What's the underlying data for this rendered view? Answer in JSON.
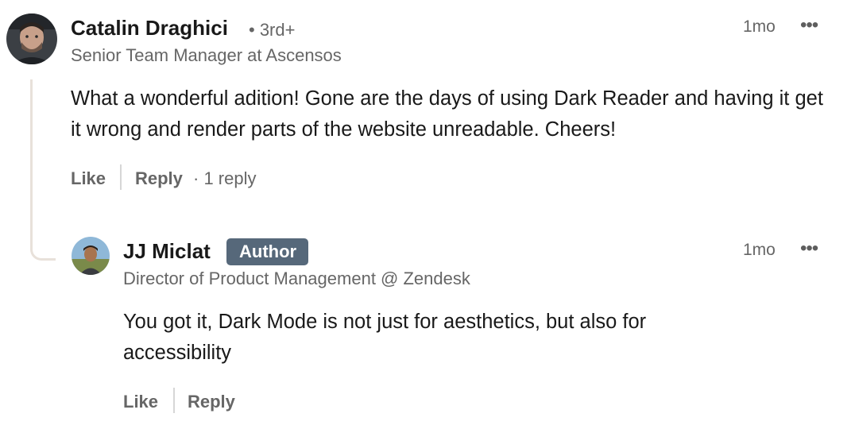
{
  "comment": {
    "author_name": "Catalin Draghici",
    "degree": "• 3rd+",
    "headline": "Senior Team Manager at Ascensos",
    "time": "1mo",
    "more_icon": "•••",
    "text": "What a wonderful adition! Gone are the days of using Dark Reader and having it get it wrong and render parts of the website unreadable. Cheers!",
    "like_label": "Like",
    "reply_label": "Reply",
    "reply_count": "· 1 reply"
  },
  "reply": {
    "author_name": "JJ Miclat",
    "badge": "Author",
    "headline": "Director of Product Management @ Zendesk",
    "time": "1mo",
    "more_icon": "•••",
    "text": "You got it, Dark Mode is not just for aesthetics, but also for accessibility",
    "like_label": "Like",
    "reply_label": "Reply"
  }
}
